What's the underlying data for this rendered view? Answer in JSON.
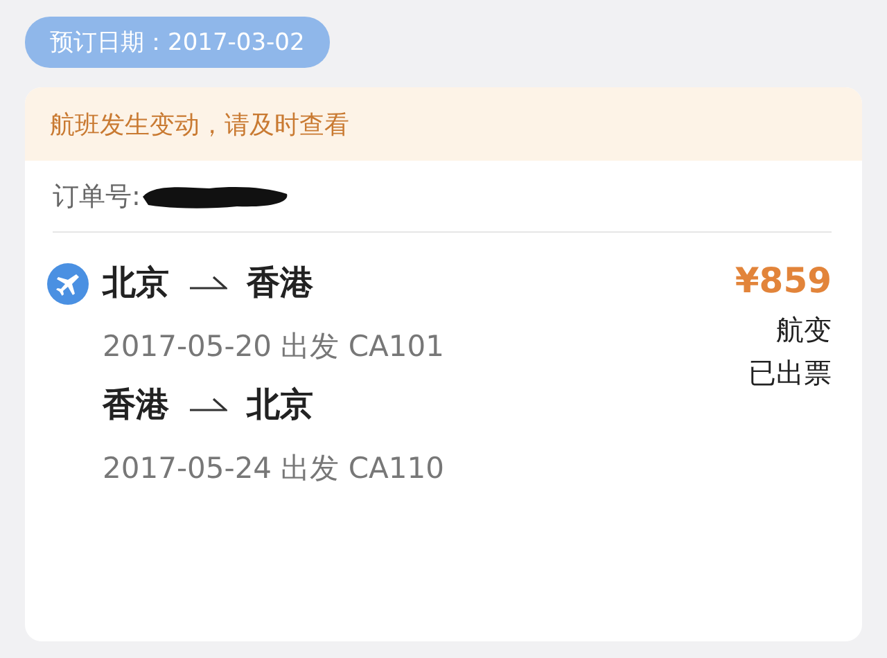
{
  "booking_date": "预订日期：2017-03-02",
  "card": {
    "notice": "航班发生变动，请及时查看",
    "order_label": "订单号:",
    "order_redacted": true,
    "flights": [
      {
        "from": "北京",
        "to": "香港",
        "detail": "2017-05-20 出发 CA101"
      },
      {
        "from": "香港",
        "to": "北京",
        "detail": "2017-05-24 出发 CA110"
      }
    ],
    "price": "¥859",
    "statuses": [
      "航变",
      "已出票"
    ]
  }
}
